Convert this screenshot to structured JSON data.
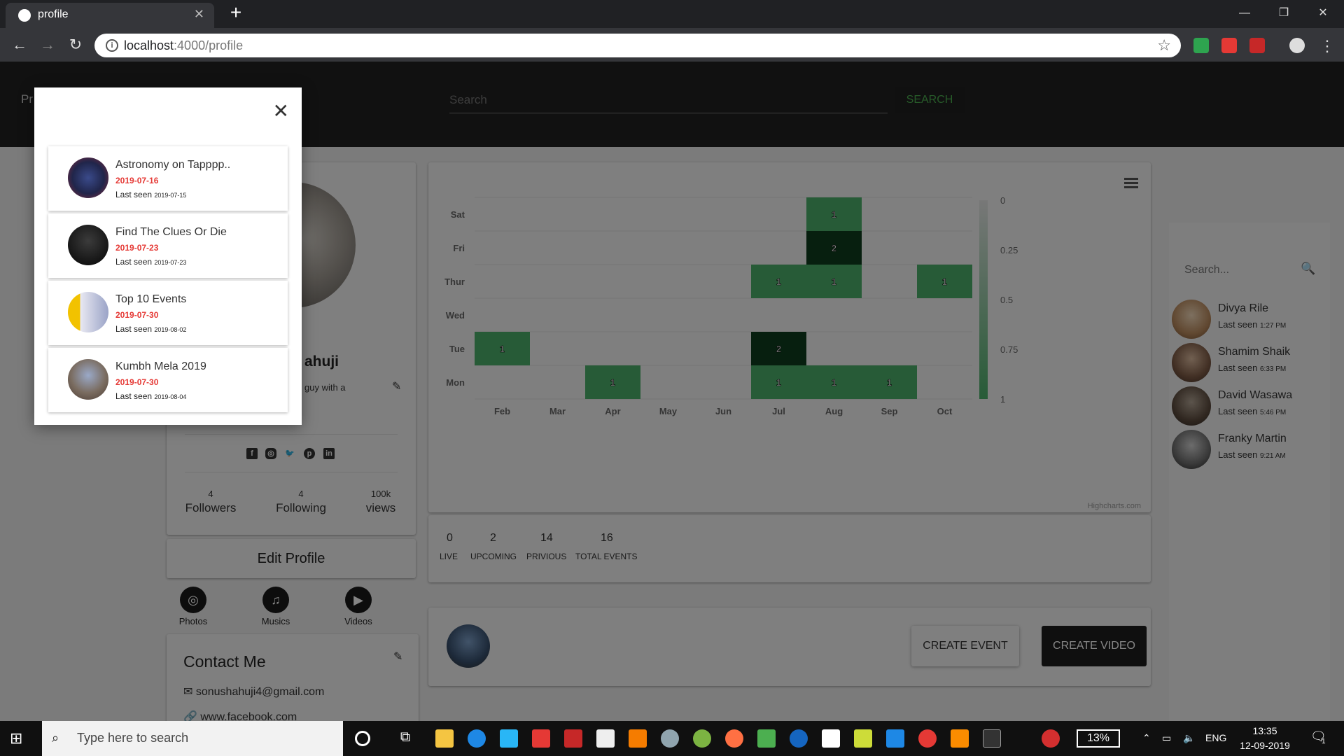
{
  "browser": {
    "tab_title": "profile",
    "url_host": "localhost",
    "url_rest": ":4000/profile"
  },
  "topnav": {
    "brand_fragment": "Pr",
    "search_placeholder": "Search",
    "search_button": "SEARCH"
  },
  "profile": {
    "name_fragment": "ahuji",
    "bio_fragment": "guy with a",
    "stats": [
      {
        "value": "4",
        "label": "Followers"
      },
      {
        "value": "4",
        "label": "Following"
      },
      {
        "value": "100k",
        "label": "views"
      }
    ],
    "edit_button": "Edit Profile",
    "media": [
      {
        "label": "Photos",
        "icon": "instagram-icon"
      },
      {
        "label": "Musics",
        "icon": "music-icon"
      },
      {
        "label": "Videos",
        "icon": "play-icon"
      }
    ],
    "contact_title": "Contact Me",
    "email": "sonushahuji4@gmail.com",
    "facebook": "www.facebook.com"
  },
  "chart_data": {
    "type": "heatmap",
    "x_categories": [
      "Feb",
      "Mar",
      "Apr",
      "May",
      "Jun",
      "Jul",
      "Aug",
      "Sep",
      "Oct"
    ],
    "y_categories": [
      "Mon",
      "Tue",
      "Wed",
      "Thur",
      "Fri",
      "Sat"
    ],
    "cells": [
      {
        "x": "Feb",
        "y": "Tue",
        "value": 1
      },
      {
        "x": "Apr",
        "y": "Mon",
        "value": 1
      },
      {
        "x": "Jul",
        "y": "Mon",
        "value": 1
      },
      {
        "x": "Jul",
        "y": "Tue",
        "value": 2
      },
      {
        "x": "Jul",
        "y": "Thur",
        "value": 1
      },
      {
        "x": "Aug",
        "y": "Mon",
        "value": 1
      },
      {
        "x": "Aug",
        "y": "Thur",
        "value": 1
      },
      {
        "x": "Aug",
        "y": "Fri",
        "value": 2
      },
      {
        "x": "Aug",
        "y": "Sat",
        "value": 1
      },
      {
        "x": "Sep",
        "y": "Mon",
        "value": 1
      },
      {
        "x": "Oct",
        "y": "Thur",
        "value": 1
      }
    ],
    "colorbar_ticks": [
      "0",
      "0.25",
      "0.5",
      "0.75",
      "1"
    ],
    "credits": "Highcharts.com",
    "colors": {
      "low": "#4caf6a",
      "high": "#0e3d1e"
    }
  },
  "events_summary": [
    {
      "value": "0",
      "label": "LIVE"
    },
    {
      "value": "2",
      "label": "UPCOMING"
    },
    {
      "value": "14",
      "label": "PRIVIOUS"
    },
    {
      "value": "16",
      "label": "TOTAL EVENTS"
    }
  ],
  "actions": {
    "create_event": "CREATE EVENT",
    "create_video": "CREATE VIDEO"
  },
  "sidebar": {
    "search_placeholder": "Search...",
    "friends": [
      {
        "name": "Divya Rile",
        "last_seen": "Last seen",
        "time": "1:27 PM"
      },
      {
        "name": "Shamim Shaik",
        "last_seen": "Last seen",
        "time": "6:33 PM"
      },
      {
        "name": "David Wasawa",
        "last_seen": "Last seen",
        "time": "5:46 PM"
      },
      {
        "name": "Franky Martin",
        "last_seen": "Last seen",
        "time": "9:21 AM"
      }
    ]
  },
  "modal": {
    "events": [
      {
        "title": "Astronomy on Tapppp..",
        "date": "2019-07-16",
        "last_seen": "Last seen",
        "seen_date": "2019-07-15"
      },
      {
        "title": "Find The Clues Or Die",
        "date": "2019-07-23",
        "last_seen": "Last seen",
        "seen_date": "2019-07-23"
      },
      {
        "title": "Top 10 Events",
        "date": "2019-07-30",
        "last_seen": "Last seen",
        "seen_date": "2019-08-02"
      },
      {
        "title": "Kumbh Mela 2019",
        "date": "2019-07-30",
        "last_seen": "Last seen",
        "seen_date": "2019-08-04"
      }
    ]
  },
  "taskbar": {
    "search_placeholder": "Type here to search",
    "battery": "13%",
    "language": "ENG",
    "time": "13:35",
    "date": "12-09-2019",
    "notification_count": "1"
  }
}
